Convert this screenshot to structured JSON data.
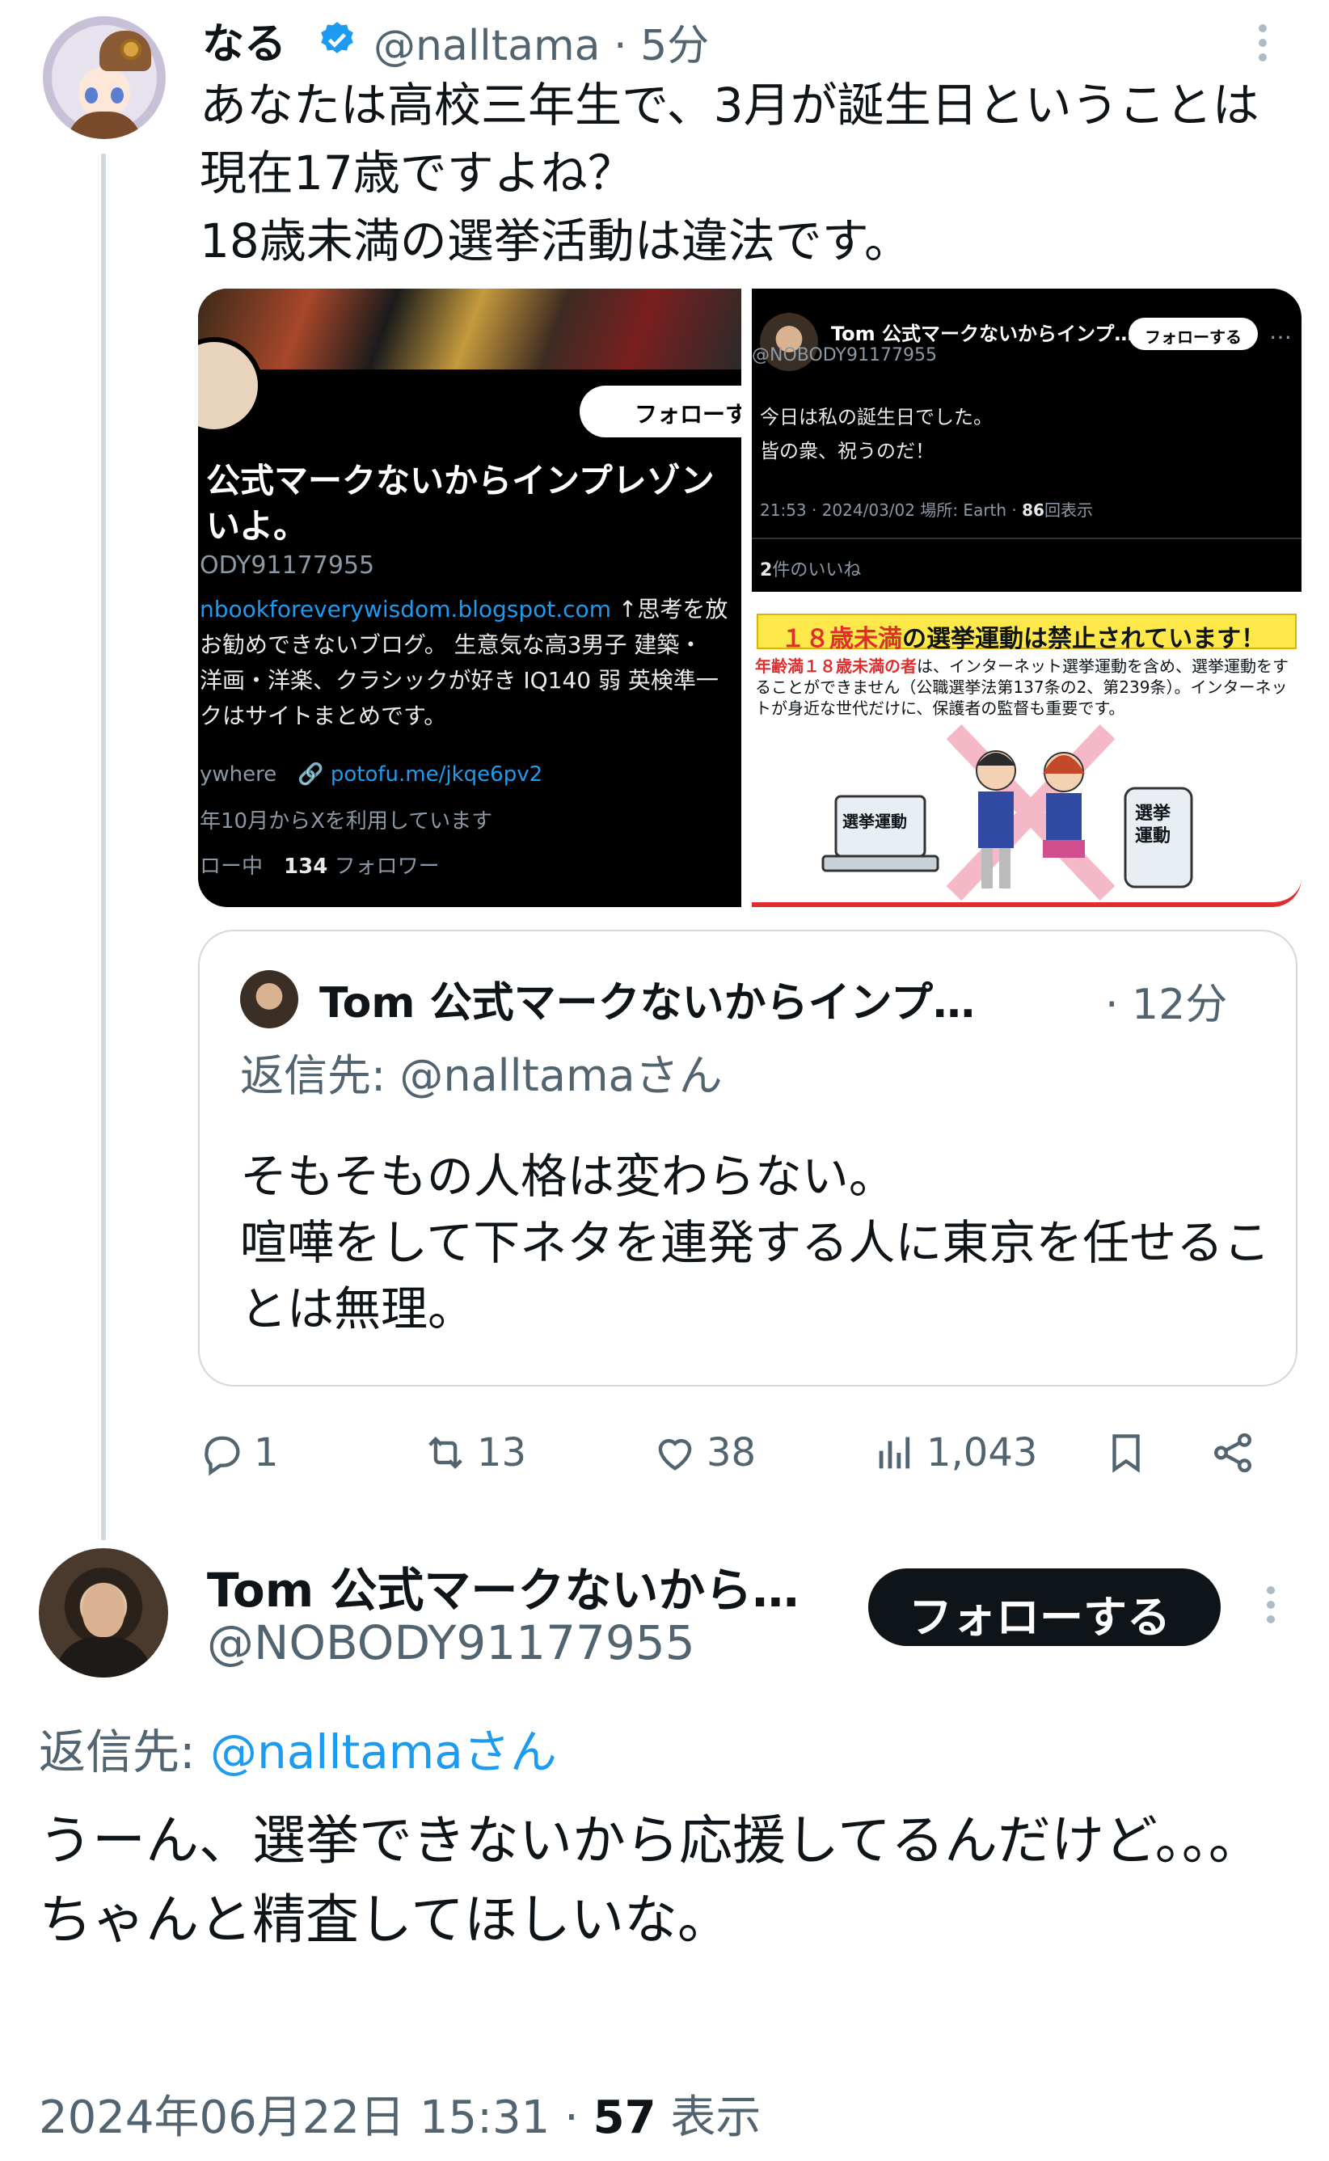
{
  "main_tweet": {
    "author_name": "なる",
    "handle": "@nalltama",
    "time": "5分",
    "body": "あなたは高校三年生で、3月が誕生日ということは現在17歳ですよね？\n18歳未満の選挙活動は違法です。",
    "media": {
      "profile_screenshot": {
        "follow_label": "フォローす",
        "name": "公式マークないからインプレゾンいよ。",
        "handle": "ODY91177955",
        "bio_link": "nbookforeverywisdom.blogspot.com",
        "bio": "↑思考を放\nお勧めできないブログ。 生意気な高3男子 建築・\n洋画・洋楽、クラシックが好き IQ140 弱 英検準一\nクはサイトまとめです。",
        "location": "ywhere",
        "location_link": "potofu.me/jkqe6pv2",
        "joined": "年10月からXを利用しています",
        "following_label": "ロー中",
        "followers_count": "134",
        "followers_label": "フォロワー"
      },
      "tweet_screenshot": {
        "name": "Tom 公式マークないからインプ…",
        "handle": "@NOBODY91177955",
        "follow_label": "フォローする",
        "more": "…",
        "body": "今日は私の誕生日でした。\n皆の衆、祝うのだ！",
        "meta": "21:53 · 2024/03/02 場所: Earth · ",
        "views_count": "86",
        "views_label": "回表示",
        "likes_count": "2",
        "likes_label": "件のいいね"
      },
      "poster": {
        "title_red": "１８歳未満",
        "title_rest": "の選挙運動は禁止されています！",
        "text_red": "年齢満１８歳未満の者",
        "text_rest": "は、インターネット選挙運動を含め、選挙運動をすることができません（公職選挙法第137条の2、第239条）。インターネットが身近な世代だけに、保護者の監督も重要です。",
        "laptop_label": "選挙運動",
        "phone_label": "選挙\n運動"
      }
    },
    "quote": {
      "author_name": "Tom 公式マークないからインプ…",
      "time": "· 12分",
      "reply_to": "返信先: @nalltamaさん",
      "body": "そもそもの人格は変わらない。\n喧嘩をして下ネタを連発する人に東京を任せることは無理。"
    },
    "actions": {
      "replies": "1",
      "retweets": "13",
      "likes": "38",
      "views": "1,043"
    }
  },
  "reply_tweet": {
    "author_name": "Tom 公式マークないから…",
    "handle": "@NOBODY91177955",
    "follow_label": "フォローする",
    "reply_prefix": "返信先: ",
    "reply_target": "@nalltamaさん",
    "body": "うーん、選挙できないから応援してるんだけど。。。\nちゃんと精査してほしいな。",
    "timestamp": "2024年06月22日 15:31 · ",
    "views_count": "57",
    "views_label": " 表示"
  },
  "colors": {
    "accent": "#1d9bf0",
    "text": "#0f1419",
    "muted": "#536471"
  }
}
